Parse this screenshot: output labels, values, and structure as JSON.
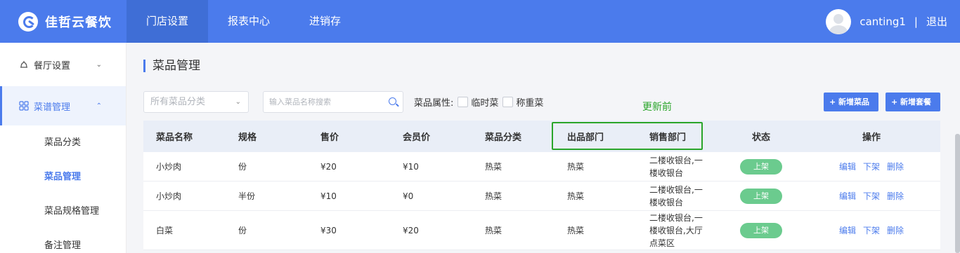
{
  "app": {
    "logo_text": "佳哲云餐饮"
  },
  "nav": [
    {
      "label": "门店设置",
      "active": true
    },
    {
      "label": "报表中心",
      "active": false
    },
    {
      "label": "进销存",
      "active": false
    }
  ],
  "user": {
    "name": "canting1",
    "separator": "|",
    "logout": "退出"
  },
  "sidebar": {
    "groups": [
      {
        "label": "餐厅设置",
        "icon": "bell-icon",
        "expanded": false
      },
      {
        "label": "菜谱管理",
        "icon": "grid-icon",
        "expanded": true,
        "children": [
          "菜品分类",
          "菜品管理",
          "菜品规格管理",
          "备注管理"
        ],
        "active_child": "菜品管理"
      }
    ]
  },
  "page": {
    "title": "菜品管理"
  },
  "filters": {
    "category_select": "所有菜品分类",
    "search_placeholder": "输入菜品名称搜索",
    "attr_label": "菜品属性:",
    "attr_options": [
      "临时菜",
      "称重菜"
    ]
  },
  "annotation": "更新前",
  "buttons": {
    "add_dish": "+ 新增菜品",
    "add_set": "+ 新增套餐"
  },
  "table": {
    "headers": [
      "菜品名称",
      "规格",
      "售价",
      "会员价",
      "菜品分类",
      "出品部门",
      "销售部门",
      "状态",
      "操作"
    ],
    "rows": [
      {
        "name": "小炒肉",
        "spec": "份",
        "price": "¥20",
        "member_price": "¥10",
        "category": "热菜",
        "output_dept": "热菜",
        "sales_dept": [
          "二楼收银台,一",
          "楼收银台"
        ],
        "status": "上架",
        "ops": [
          "编辑",
          "下架",
          "删除"
        ]
      },
      {
        "name": "小炒肉",
        "spec": "半份",
        "price": "¥10",
        "member_price": "¥0",
        "category": "热菜",
        "output_dept": "热菜",
        "sales_dept": [
          "二楼收银台,一",
          "楼收银台"
        ],
        "status": "上架",
        "ops": [
          "编辑",
          "下架",
          "删除"
        ]
      },
      {
        "name": "白菜",
        "spec": "份",
        "price": "¥30",
        "member_price": "¥20",
        "category": "热菜",
        "output_dept": "热菜",
        "sales_dept": [
          "二楼收银台,一",
          "楼收银台,大厅",
          "点菜区"
        ],
        "status": "上架",
        "ops": [
          "编辑",
          "下架",
          "删除"
        ]
      }
    ]
  },
  "colors": {
    "primary": "#4b7bec",
    "status_green": "#6bcb8e",
    "annotation_green": "#2aa52a"
  }
}
